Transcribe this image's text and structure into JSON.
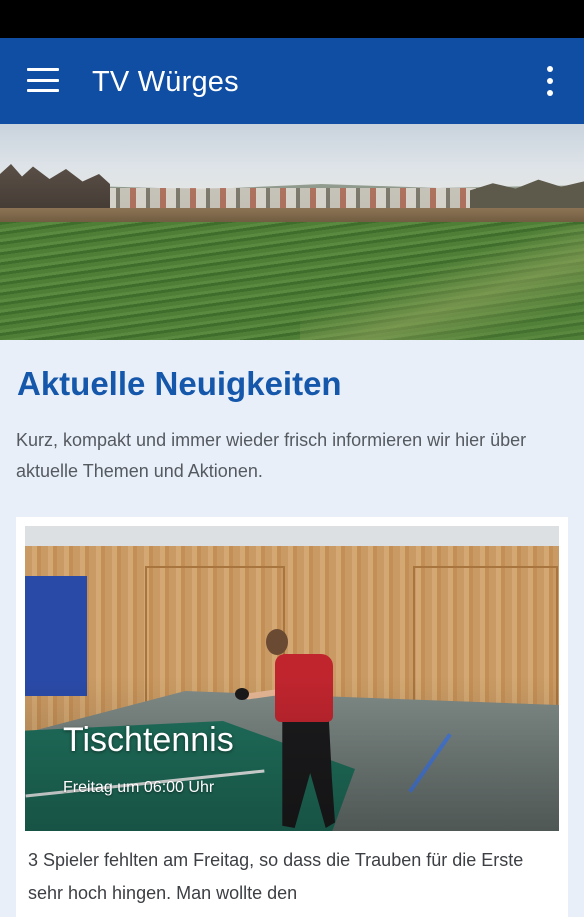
{
  "app_bar": {
    "title": "TV Würges",
    "menu_icon": "hamburger-menu-icon",
    "overflow_icon": "more-vert-icon",
    "color": "#0f4ea3"
  },
  "news": {
    "heading": "Aktuelle Neuigkeiten",
    "description": "Kurz, kompakt und immer wieder frisch informieren wir hier über aktuelle Themen und Aktionen.",
    "heading_color": "#1557ab"
  },
  "card": {
    "title": "Tischtennis",
    "subtitle": "Freitag um 06:00 Uhr",
    "excerpt": "3 Spieler fehlten am Freitag, so dass die Trauben für die Erste sehr hoch hingen. Man wollte den"
  }
}
